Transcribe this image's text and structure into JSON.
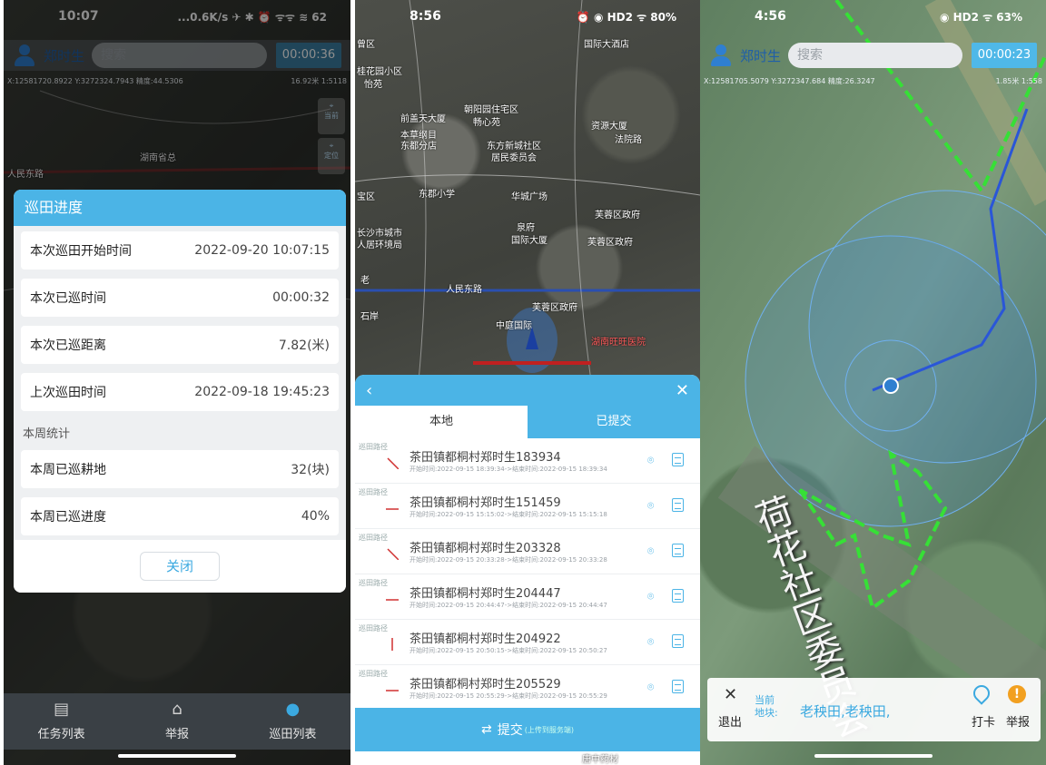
{
  "panel1": {
    "status": {
      "time": "10:07",
      "right": "...0.6K/s ✈ ✱ ⏰ ᯤᯤ ≋ 62"
    },
    "topbar": {
      "user": "郑时生",
      "search_placeholder": "搜索",
      "timer": "00:00:36"
    },
    "coords": "X:12581720.8922 Y:3272324.7943 精度:44.5306",
    "scale": "16.92米 1:5118",
    "side_buttons": [
      "当前",
      "定位"
    ],
    "modal": {
      "title": "巡田进度",
      "rows": [
        {
          "label": "本次巡田开始时间",
          "value": "2022-09-20 10:07:15"
        },
        {
          "label": "本次已巡时间",
          "value": "00:00:32"
        },
        {
          "label": "本次已巡距离",
          "value": "7.82(米)"
        },
        {
          "label": "上次巡田时间",
          "value": "2022-09-18 19:45:23"
        }
      ],
      "section": "本周统计",
      "week_rows": [
        {
          "label": "本周已巡耕地",
          "value": "32(块)"
        },
        {
          "label": "本周已巡进度",
          "value": "40%"
        }
      ],
      "close": "关闭"
    },
    "map_labels": [
      "人民东路",
      "湖南省总"
    ],
    "nav": [
      {
        "label": "任务列表",
        "icon": "list-icon"
      },
      {
        "label": "举报",
        "icon": "house-icon"
      },
      {
        "label": "巡田列表",
        "icon": "chat-icon"
      }
    ]
  },
  "panel2": {
    "status": {
      "time": "8:56",
      "right": "⏰ ◉ HD2 ᯤ 80%"
    },
    "map_labels": [
      "曾区",
      "桂花园小区",
      "怡苑",
      "朝阳园住宅区",
      "畅心苑",
      "国际大酒店",
      "前盖天大厦",
      "本草纲目",
      "东都分店",
      "东方新城社区",
      "居民委员会",
      "资源大厦",
      "法院路",
      "宝区",
      "东郡小学",
      "华城广场",
      "芙蓉区政府",
      "长沙市城市",
      "人居环境局",
      "泉府",
      "国际大厦",
      "芙蓉区政府",
      "人民东路",
      "芙蓉区政府",
      "中庭国际",
      "湖南旺旺医院",
      "老",
      "石岸"
    ],
    "tabs": [
      "本地",
      "已提交"
    ],
    "items": [
      {
        "tag": "巡田路径",
        "title": "茶田镇都桐村郑时生183934",
        "sub": "开始时间:2022-09-15 18:39:34->结束时间:2022-09-15 18:39:34",
        "shape": "diag"
      },
      {
        "tag": "巡田路径",
        "title": "茶田镇都桐村郑时生151459",
        "sub": "开始时间:2022-09-15 15:15:02->结束时间:2022-09-15 15:15:18",
        "shape": "flat"
      },
      {
        "tag": "巡田路径",
        "title": "茶田镇都桐村郑时生203328",
        "sub": "开始时间:2022-09-15 20:33:28->结束时间:2022-09-15 20:33:28",
        "shape": "diag"
      },
      {
        "tag": "巡田路径",
        "title": "茶田镇都桐村郑时生204447",
        "sub": "开始时间:2022-09-15 20:44:47->结束时间:2022-09-15 20:44:47",
        "shape": "flat"
      },
      {
        "tag": "巡田路径",
        "title": "茶田镇都桐村郑时生204922",
        "sub": "开始时间:2022-09-15 20:50:15->结束时间:2022-09-15 20:50:27",
        "shape": "vert"
      },
      {
        "tag": "巡田路径",
        "title": "茶田镇都桐村郑时生205529",
        "sub": "开始时间:2022-09-15 20:55:29->结束时间:2022-09-15 20:55:29",
        "shape": "flat"
      }
    ],
    "submit": "提交",
    "submit_small": "(上传到服务端)",
    "footer": "唐中药材"
  },
  "panel3": {
    "status": {
      "time": "4:56",
      "right": "◉ HD2 ᯤ 63%"
    },
    "topbar": {
      "user": "郑时生",
      "search_placeholder": "搜索",
      "timer": "00:00:23"
    },
    "coords": "X:12581705.5079 Y:3272347.684 精度:26.3247",
    "scale": "1.85米 1:558",
    "map_text": "荷花社区委员会",
    "bottom": {
      "exit": "退出",
      "current": "当前",
      "plot_label": "地块:",
      "plots": "老秧田,老秧田,",
      "checkin": "打卡",
      "report": "举报"
    }
  },
  "colors": {
    "accent": "#4bb4e6",
    "user_blue": "#2f7fd0"
  }
}
